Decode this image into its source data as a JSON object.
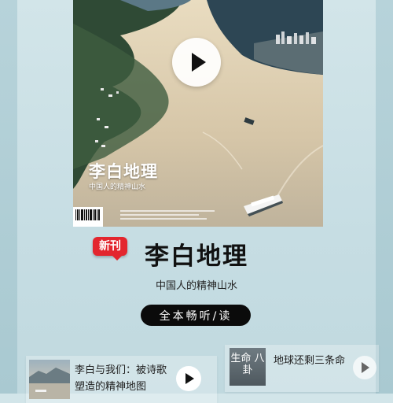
{
  "cover": {
    "title": "李白地理",
    "subtitle": "中国人的精神山水"
  },
  "badge": "新刊",
  "magazine": {
    "title": "李白地理",
    "subtitle": "中国人的精神山水"
  },
  "action_button": "全本畅听/读",
  "cards": [
    {
      "title": "李白与我们：被诗歌塑造的精神地图"
    },
    {
      "title": "地球还剩三条命",
      "thumb_text": "生命 八卦"
    }
  ],
  "colors": {
    "badge": "#e3262e",
    "button": "#0b0b0b",
    "background": "#c6dde3"
  },
  "icons": [
    "play-icon",
    "barcode-icon"
  ]
}
